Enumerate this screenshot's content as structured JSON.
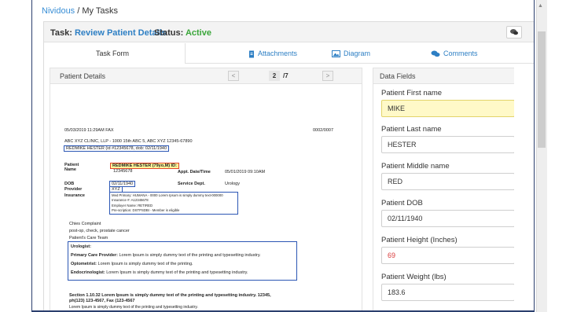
{
  "breadcrumb": {
    "link": "Nividous",
    "separator": " / ",
    "current": "My Tasks"
  },
  "task": {
    "label": "Task:",
    "name": "Review Patient Details",
    "status_label": "Status:",
    "status": "Active",
    "status_color": "#3aa63a"
  },
  "tabs": [
    {
      "label": "Task Form",
      "icon": ""
    },
    {
      "label": "Attachments",
      "icon": "attachment-icon"
    },
    {
      "label": "Diagram",
      "icon": "image-icon"
    },
    {
      "label": "Comments",
      "icon": "comments-icon"
    }
  ],
  "document_panel": {
    "title": "Patient Details",
    "prev": "<",
    "next": ">",
    "page": "2",
    "total": "/7"
  },
  "document": {
    "fax_line": "05/03/2019  11:29AM FAX",
    "page_code": "0002/0007",
    "clinic_line": "ABC XYZ CLINIC, LLP - 1000 15th ABC 5, ABC XYZ 12345-67890",
    "patient_line": "REDMIKE HESTER (id #12345678, dob: 02/11/1940",
    "patient_name_label": "Patient\nName",
    "patient_name_value": "REDMIKE HESTER (79yo,M) ID:",
    "patient_id_value": "12345678",
    "appt_label": "Appt. Date/Time",
    "appt_value": "05/01/2019 09:10AM",
    "dob_label": "DOB",
    "dob_value": "02/11/1940",
    "provider_label": "Provider",
    "provider_value": "XYZ",
    "service_label": "Service Dept.",
    "service_value": "Urology",
    "insurance_label": "Insurance",
    "insurance_lines": [
      "Med Primary: HUMANA - 0000 Lorem Ipsum is simply dummy text-000000",
      "Insurance #: A12345678",
      "Employer Name: RETIRED",
      "Pre-scription: DSTPSDBI - Member is eligible"
    ],
    "complaint_title": "Chies Complaint",
    "complaint_text": "post-op, check, prostate cancer",
    "care_team_title": "Patient's Care Team",
    "care_team": [
      {
        "role": "Urologist:",
        "text": ""
      },
      {
        "role": "Primary Care Provider:",
        "text": " Lorem Ipsum is simply dummy text of the printing and typesetting industry."
      },
      {
        "role": "Optometrist:",
        "text": " Lorem Ipsum is simply dummy text of the printing."
      },
      {
        "role": "Endocrinologist:",
        "text": " Lorem Ipsum is simply dummy text of the printing and typesetting industry."
      }
    ],
    "section_line1": "Section 1.10.32 Lorem Ipsum is simply dummy text of the printing and typesetting industry.  12345,",
    "section_line2": "ph(123) 123-4567, Fax (123-4567",
    "section_line3": "Lorem Ipsum is simply dummy text of the printing and typesetting industry."
  },
  "fields_panel": {
    "title": "Data Fields"
  },
  "fields": [
    {
      "label": "Patient First name",
      "value": "MIKE"
    },
    {
      "label": "Patient Last name",
      "value": "HESTER"
    },
    {
      "label": "Patient Middle name",
      "value": "RED"
    },
    {
      "label": "Patient DOB",
      "value": "02/11/1940"
    },
    {
      "label": "Patient Height (Inches)",
      "value": "69"
    },
    {
      "label": "Patient Weight (lbs)",
      "value": "183.6"
    }
  ],
  "colors": {
    "link": "#3a8fd6",
    "highlight_field": "#fff9c8",
    "error_value": "#d93a3a",
    "frame_border": "#2b3f6e"
  }
}
